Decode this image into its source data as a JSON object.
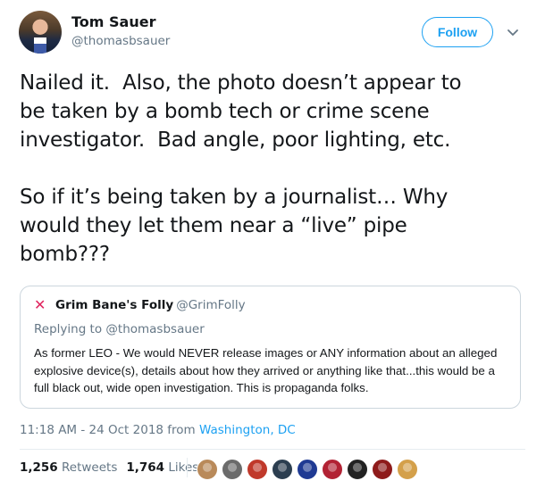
{
  "author": {
    "name": "Tom Sauer",
    "handle": "@thomasbsauer"
  },
  "follow_label": "Follow",
  "tweet_text": "Nailed it.  Also, the photo doesn’t appear to\nbe taken by a bomb tech or crime scene\ninvestigator.  Bad angle, poor lighting, etc.\n\nSo if it’s being taken by a journalist… Why\nwould they let them near a “live” pipe\nbomb???",
  "quote": {
    "icon": "red-x",
    "name": "Grim Bane's Folly",
    "handle": "@GrimFolly",
    "replying_to": "Replying to @thomasbsauer",
    "text": "As former LEO - We would NEVER release images or ANY information about an alleged explosive device(s), details about how they arrived or anything like that...this would be a full black out, wide open investigation. This is propaganda folks."
  },
  "timestamp": "11:18 AM - 24 Oct 2018 from",
  "location": "Washington, DC",
  "stats": {
    "retweets_count": "1,256",
    "retweets_label": "Retweets",
    "likes_count": "1,764",
    "likes_label": "Likes"
  },
  "liker_avatars": [
    {
      "icon": "dog-avatar",
      "color": "#b98a5a"
    },
    {
      "icon": "person-avatar",
      "color": "#6b6b6b"
    },
    {
      "icon": "person-avatar",
      "color": "#c0392b"
    },
    {
      "icon": "person-avatar",
      "color": "#2c3e50"
    },
    {
      "icon": "flag-avatar",
      "color": "#1f3a93"
    },
    {
      "icon": "flag-avatar",
      "color": "#b22234"
    },
    {
      "icon": "dog-avatar",
      "color": "#222222"
    },
    {
      "icon": "person-avatar",
      "color": "#8e1b1b"
    },
    {
      "icon": "landscape-avatar",
      "color": "#d4a04a"
    }
  ],
  "colors": {
    "accent": "#1da1f2",
    "text": "#14171a",
    "secondary": "#657786",
    "red_x": "#e0245e"
  }
}
